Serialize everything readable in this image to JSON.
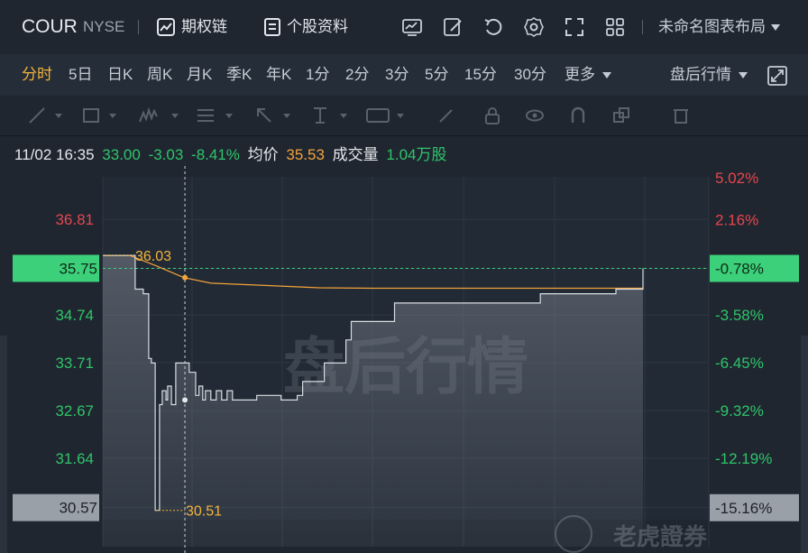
{
  "header": {
    "symbol": "COUR",
    "exchange": "NYSE",
    "options_chain": "期权链",
    "stock_info": "个股资料",
    "layout_name": "未命名图表布局"
  },
  "icons": [
    "chart-icon",
    "list-doc-icon",
    "indicator-icon",
    "edit-icon",
    "undo-icon",
    "settings-icon",
    "fullscreen-icon",
    "grid-layout-icon",
    "expand-icon"
  ],
  "periods": [
    "分时",
    "5日",
    "日K",
    "周K",
    "月K",
    "季K",
    "年K",
    "1分",
    "2分",
    "3分",
    "5分",
    "15分",
    "30分",
    "更多"
  ],
  "active_period": "分时",
  "after_hours_label": "盘后行情",
  "info": {
    "datetime": "11/02 16:35",
    "price": "33.00",
    "change": "-3.03",
    "change_pct": "-8.41%",
    "avg_label": "均价",
    "avg_value": "35.53",
    "volume_label": "成交量",
    "volume_value": "1.04万股"
  },
  "colors": {
    "up": "#e5474f",
    "down": "#2fc46a",
    "avg_line": "#f3a33a",
    "accent": "#f3b43c",
    "price_line": "#d9dde3",
    "crosshair": "#c9ced6",
    "prev_close": "#3cd07a"
  },
  "chart_data": {
    "type": "line",
    "watermark": "盘后行情",
    "left_ticks": [
      "36.81",
      "35.75",
      "34.74",
      "33.71",
      "32.67",
      "31.64",
      "30.57"
    ],
    "right_ticks": [
      "5.02%",
      "2.16%",
      "-0.78%",
      "-3.58%",
      "-6.45%",
      "-9.32%",
      "-12.19%",
      "-15.16%"
    ],
    "ylim": [
      30.29,
      37.83
    ],
    "prev_close": 36.03,
    "highlighted_price": "35.75",
    "highlighted_pct": "-0.78%",
    "bottom_price": "30.57",
    "bottom_pct": "-15.16%",
    "high_label": "36.03",
    "low_label": "30.51",
    "price_series": [
      [
        0,
        36.03
      ],
      [
        0.02,
        36.03
      ],
      [
        0.04,
        36.03
      ],
      [
        0.06,
        35.3
      ],
      [
        0.075,
        35.2
      ],
      [
        0.085,
        33.8
      ],
      [
        0.09,
        33.7
      ],
      [
        0.097,
        30.51
      ],
      [
        0.105,
        32.8
      ],
      [
        0.11,
        33.1
      ],
      [
        0.117,
        32.9
      ],
      [
        0.12,
        33.2
      ],
      [
        0.127,
        32.8
      ],
      [
        0.135,
        33.7
      ],
      [
        0.145,
        33.7
      ],
      [
        0.152,
        33.7
      ],
      [
        0.16,
        33.5
      ],
      [
        0.167,
        33.5
      ],
      [
        0.172,
        33.0
      ],
      [
        0.178,
        33.2
      ],
      [
        0.185,
        32.9
      ],
      [
        0.19,
        33.1
      ],
      [
        0.2,
        32.9
      ],
      [
        0.21,
        33.1
      ],
      [
        0.22,
        32.9
      ],
      [
        0.23,
        33.1
      ],
      [
        0.24,
        32.9
      ],
      [
        0.275,
        32.9
      ],
      [
        0.285,
        33.0
      ],
      [
        0.32,
        33.0
      ],
      [
        0.33,
        32.9
      ],
      [
        0.35,
        32.9
      ],
      [
        0.36,
        33.0
      ],
      [
        0.37,
        33.3
      ],
      [
        0.4,
        33.3
      ],
      [
        0.41,
        33.7
      ],
      [
        0.44,
        33.7
      ],
      [
        0.45,
        34.2
      ],
      [
        0.46,
        34.6
      ],
      [
        0.53,
        34.6
      ],
      [
        0.54,
        35.0
      ],
      [
        0.7,
        35.0
      ],
      [
        0.72,
        35.0
      ],
      [
        0.8,
        35.0
      ],
      [
        0.81,
        35.2
      ],
      [
        0.94,
        35.2
      ],
      [
        0.95,
        35.3
      ],
      [
        0.99,
        35.3
      ],
      [
        1.0,
        35.75
      ]
    ],
    "avg_series": [
      [
        0,
        36.03
      ],
      [
        0.05,
        36.03
      ],
      [
        0.1,
        35.8
      ],
      [
        0.15,
        35.55
      ],
      [
        0.2,
        35.43
      ],
      [
        0.3,
        35.38
      ],
      [
        0.4,
        35.33
      ],
      [
        0.5,
        35.32
      ],
      [
        0.6,
        35.32
      ],
      [
        0.7,
        35.32
      ],
      [
        0.8,
        35.32
      ],
      [
        0.9,
        35.32
      ],
      [
        1.0,
        35.32
      ]
    ],
    "crosshair_at": 0.152
  },
  "brand": "老虎證券"
}
